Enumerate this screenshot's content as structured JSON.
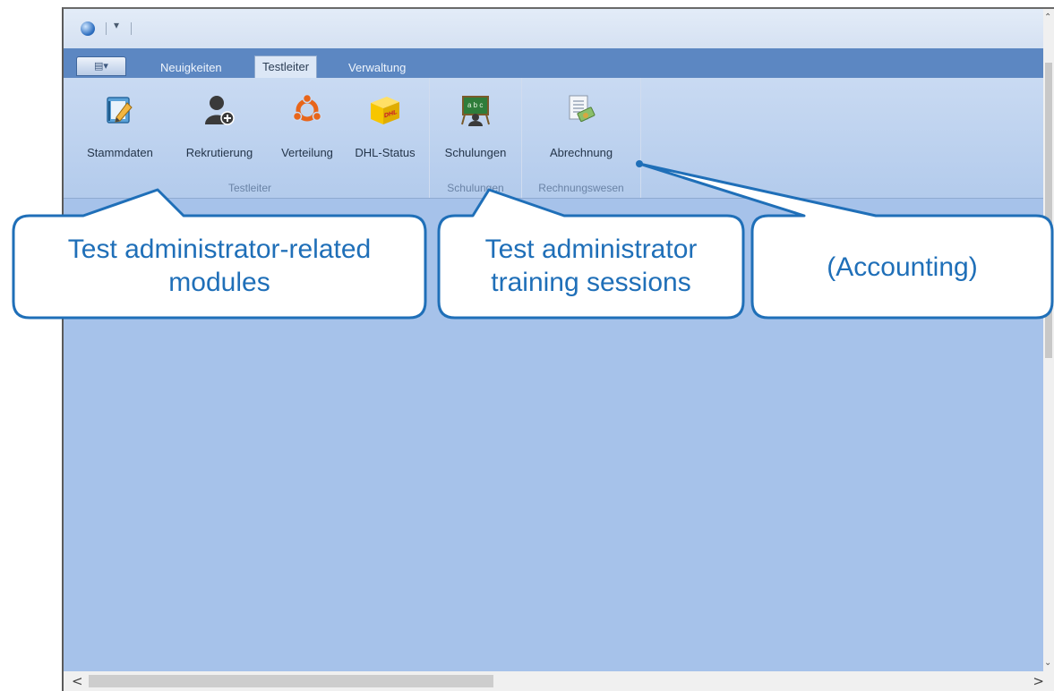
{
  "window": {
    "quick_access_dropdown": "▾",
    "app_button": "▤▾"
  },
  "tabs": [
    {
      "label": "Neuigkeiten",
      "active": false
    },
    {
      "label": "Testleiter",
      "active": true
    },
    {
      "label": "Verwaltung",
      "active": false
    }
  ],
  "ribbon": {
    "groups": [
      {
        "label": "Testleiter",
        "buttons": [
          {
            "label": "Stammdaten",
            "icon": "notepad-pencil-icon"
          },
          {
            "label": "Rekrutierung",
            "icon": "add-user-icon"
          },
          {
            "label": "Verteilung",
            "icon": "distribution-icon"
          },
          {
            "label": "DHL-Status",
            "icon": "dhl-package-icon"
          }
        ]
      },
      {
        "label": "Schulungen",
        "buttons": [
          {
            "label": "Schulungen",
            "icon": "chalkboard-icon"
          }
        ]
      },
      {
        "label": "Rechnungswesen",
        "buttons": [
          {
            "label": "Abrechnung",
            "icon": "invoice-icon"
          }
        ]
      }
    ]
  },
  "scrollbars": {
    "left_arrow": "<",
    "right_arrow": ">"
  },
  "callouts": [
    {
      "text": "Test administrator-related modules"
    },
    {
      "text": "Test administrator training sessions"
    },
    {
      "text": "(Accounting)"
    }
  ],
  "colors": {
    "tab_bar": "#5c87c2",
    "ribbon": "#b3cbec",
    "content": "#a6c2ea",
    "callout_border": "#1f6fb8"
  }
}
